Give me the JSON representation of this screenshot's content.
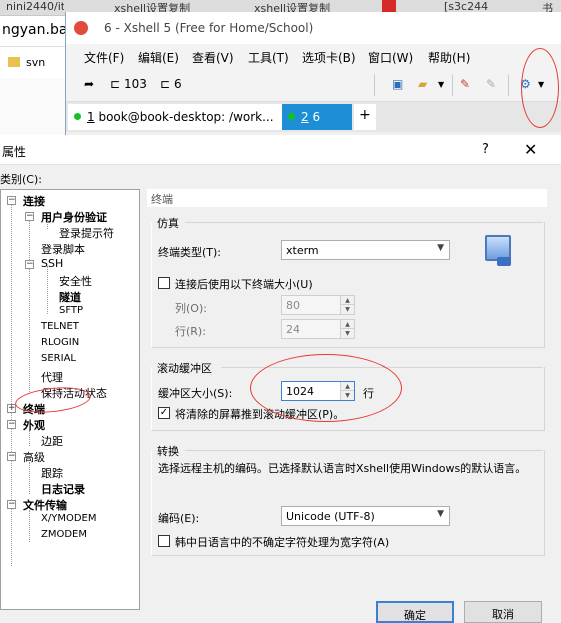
{
  "browser": {
    "tabs": [
      "nini2440/it",
      "xshell设置复制",
      "xshell设置复制",
      "",
      "[s3c244",
      "书"
    ],
    "url_fragment": "ngyan.bai",
    "bookmark": "svn"
  },
  "xshell": {
    "title": "6 - Xshell 5 (Free for Home/School)",
    "menu": [
      "文件(F)",
      "编辑(E)",
      "查看(V)",
      "工具(T)",
      "选项卡(B)",
      "窗口(W)",
      "帮助(H)"
    ],
    "toolbar": {
      "btn1": "103",
      "btn2": "6"
    },
    "session_tabs": [
      {
        "num": "1",
        "label": "book@book-desktop: /work..."
      },
      {
        "num": "2",
        "label": "6"
      }
    ],
    "new_tab": "+"
  },
  "dialog": {
    "title": "属性",
    "help": "?",
    "close": "✕",
    "category_label": "类别(C):",
    "tree": [
      {
        "label": "连接",
        "bold": true
      },
      {
        "label": "用户身份验证",
        "bold": true
      },
      {
        "label": "登录提示符",
        "bold": false
      },
      {
        "label": "登录脚本",
        "bold": false
      },
      {
        "label": "SSH",
        "bold": false
      },
      {
        "label": "安全性",
        "bold": false
      },
      {
        "label": "隧道",
        "bold": true
      },
      {
        "label": "SFTP",
        "bold": false
      },
      {
        "label": "TELNET",
        "bold": false
      },
      {
        "label": "RLOGIN",
        "bold": false
      },
      {
        "label": "SERIAL",
        "bold": false
      },
      {
        "label": "代理",
        "bold": false
      },
      {
        "label": "保持活动状态",
        "bold": false
      },
      {
        "label": "终端",
        "bold": true
      },
      {
        "label": "外观",
        "bold": true
      },
      {
        "label": "边距",
        "bold": false
      },
      {
        "label": "高级",
        "bold": false
      },
      {
        "label": "跟踪",
        "bold": false
      },
      {
        "label": "日志记录",
        "bold": true
      },
      {
        "label": "文件传输",
        "bold": true
      },
      {
        "label": "X/YMODEM",
        "bold": false
      },
      {
        "label": "ZMODEM",
        "bold": false
      }
    ],
    "panel": {
      "header": "终端",
      "emulation": {
        "group": "仿真",
        "terminal_type_label": "终端类型(T):",
        "terminal_type_value": "xterm",
        "use_size_label": "连接后使用以下终端大小(U)",
        "cols_label": "列(O):",
        "cols_value": "80",
        "rows_label": "行(R):",
        "rows_value": "24"
      },
      "scrollback": {
        "group": "滚动缓冲区",
        "size_label": "缓冲区大小(S):",
        "size_value": "1024",
        "unit": "行",
        "push_label": "将清除的屏幕推到滚动缓冲区(P)。",
        "push_checked": "✓"
      },
      "translation": {
        "group": "转换",
        "description": "选择远程主机的编码。已选择默认语言时Xshell使用Windows的默认语言。",
        "encoding_label": "编码(E):",
        "encoding_value": "Unicode (UTF-8)",
        "cjk_label": "韩中日语言中的不确定字符处理为宽字符(A)"
      }
    },
    "buttons": {
      "ok": "确定",
      "cancel": "取消"
    }
  }
}
